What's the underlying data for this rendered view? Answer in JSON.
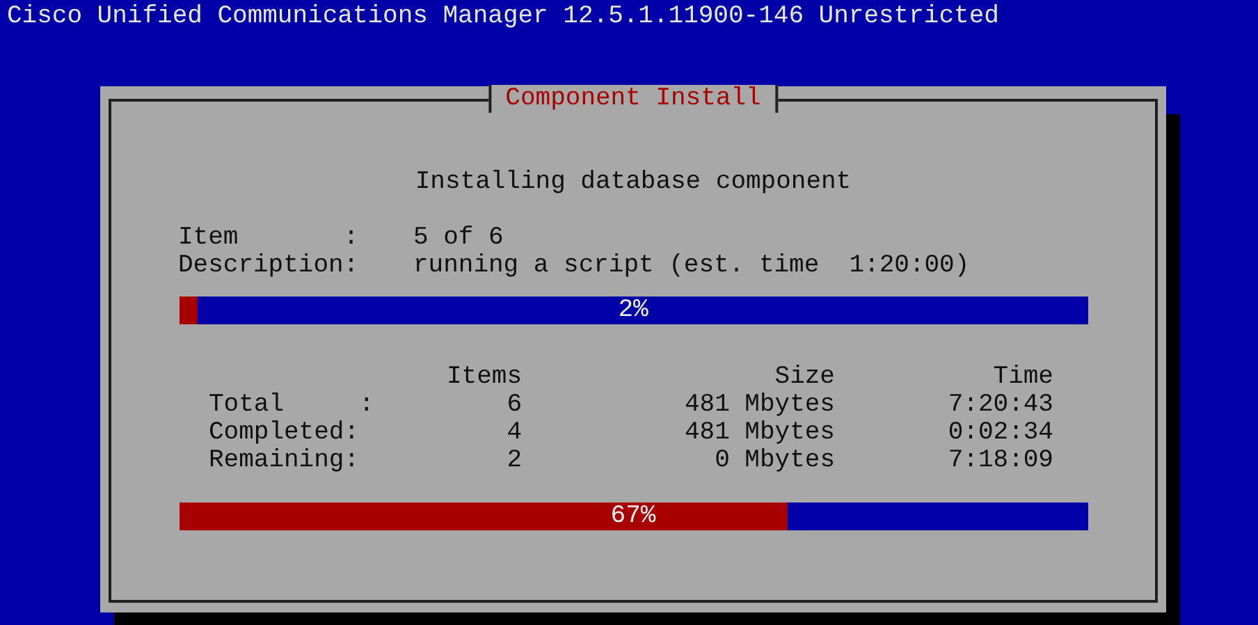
{
  "header": {
    "title": "Cisco Unified Communications Manager 12.5.1.11900-146 Unrestricted"
  },
  "dialog": {
    "title": "Component Install",
    "heading": "Installing database component",
    "fields": [
      {
        "label": "Item       :",
        "value": "5 of 6"
      },
      {
        "label": "Description:",
        "value": "running a script (est. time  1:20:00)"
      }
    ],
    "item_progress": {
      "level": 0.02,
      "reading": "2%"
    },
    "table": {
      "columns": [
        "Items",
        "Size",
        "Time"
      ],
      "rows": [
        {
          "label": "Total     :",
          "cells": [
            "6",
            "481 Mbytes",
            "7:20:43"
          ]
        },
        {
          "label": "Completed:",
          "cells": [
            "4",
            "481 Mbytes",
            "0:02:34"
          ]
        },
        {
          "label": "Remaining:",
          "cells": [
            "2",
            "0 Mbytes",
            "7:18:09"
          ]
        }
      ]
    },
    "overall_progress": {
      "level": 0.67,
      "reading": "67%"
    }
  }
}
